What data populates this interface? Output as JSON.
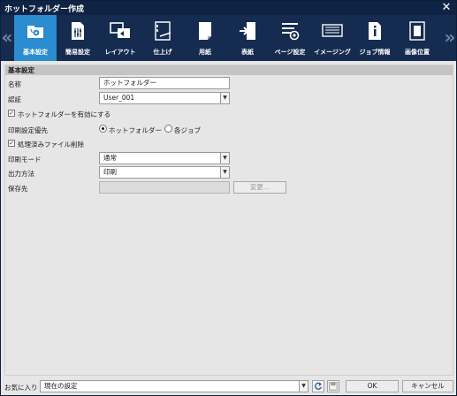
{
  "window": {
    "title": "ホットフォルダー作成"
  },
  "toolbar": {
    "items": [
      {
        "label": "基本設定",
        "icon": "folder-gear-icon",
        "active": true
      },
      {
        "label": "簡易設定",
        "icon": "sliders-icon",
        "active": false
      },
      {
        "label": "レイアウト",
        "icon": "layout-icon",
        "active": false
      },
      {
        "label": "仕上げ",
        "icon": "finishing-icon",
        "active": false
      },
      {
        "label": "用紙",
        "icon": "paper-icon",
        "active": false
      },
      {
        "label": "表紙",
        "icon": "cover-insert-icon",
        "active": false
      },
      {
        "label": "ページ設定",
        "icon": "page-settings-icon",
        "active": false
      },
      {
        "label": "イメージング",
        "icon": "imaging-icon",
        "active": false
      },
      {
        "label": "ジョブ情報",
        "icon": "info-icon",
        "active": false
      },
      {
        "label": "画像位置",
        "icon": "image-position-icon",
        "active": false
      }
    ]
  },
  "section": {
    "title": "基本設定"
  },
  "form": {
    "name_label": "名称",
    "name_value": "ホットフォルダー",
    "auth_label": "認証",
    "auth_value": "User_001",
    "enable_label": "ホットフォルダーを有効にする",
    "enable_checked": true,
    "priority_label": "印刷設定優先",
    "priority_options": [
      "ホットフォルダー",
      "各ジョブ"
    ],
    "priority_selected": "ホットフォルダー",
    "delete_label": "処理済みファイル削除",
    "delete_checked": true,
    "mode_label": "印刷モード",
    "mode_value": "通常",
    "output_label": "出力方法",
    "output_value": "印刷",
    "dest_label": "保存先",
    "dest_value": "",
    "change_label": "変更..."
  },
  "footer": {
    "favorites_label": "お気に入り",
    "favorites_value": "現在の設定",
    "ok_label": "OK",
    "cancel_label": "キャンセル"
  },
  "colors": {
    "titlebar": "#0f2344",
    "toolbar": "#152b4f",
    "active_tab": "#2b8cd0"
  }
}
